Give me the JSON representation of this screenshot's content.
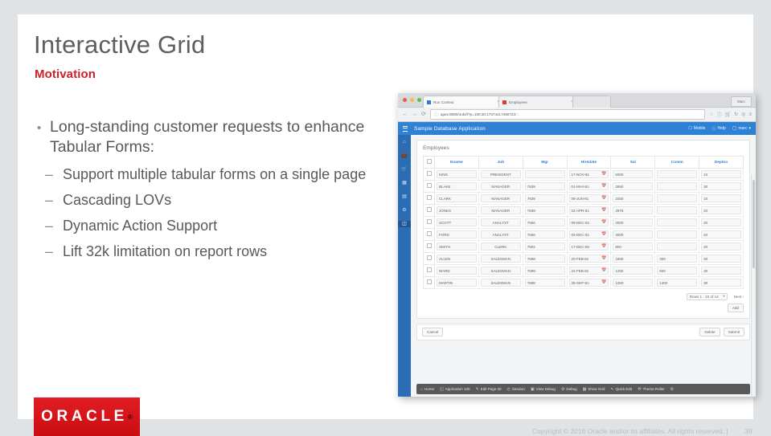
{
  "slide": {
    "title": "Interactive Grid",
    "subtitle": "Motivation",
    "bullets": {
      "main": "Long-standing customer requests to enhance Tabular Forms:",
      "bullet_marker": "•",
      "dash_marker": "–",
      "sub": [
        "Support multiple tabular forms on a single page",
        "Cascading LOVs",
        "Dynamic Action Support",
        "Lift 32k limitation on report rows"
      ]
    },
    "logo": {
      "word": "ORACLE",
      "registered": "®"
    },
    "footer": {
      "copyright": "Copyright © 2016 Oracle and/or its affiliates. All rights reserved.  |",
      "page_number": "39"
    },
    "colors": {
      "accent_red": "#cc2127",
      "title_gray": "#5b5f61",
      "oracle_red": "#d90b0b",
      "apex_blue": "#2f81d6"
    }
  },
  "screenshot": {
    "browser": {
      "window_buttons": [
        "close",
        "minimize",
        "zoom"
      ],
      "tabs": [
        {
          "label": "Run Context",
          "favicon": "blue-page-icon",
          "close": "×"
        },
        {
          "label": "Employees",
          "favicon": "red-page-icon",
          "close": "×"
        }
      ],
      "mac_menu_label": "Marc",
      "nav": {
        "back": "←",
        "forward": "→",
        "reload": "⟳",
        "lock_icon": "ⓘ",
        "url": "apex:8080/ords/f?p=100:30:17674417490723:::",
        "bookmark_icon": "☆",
        "info_icon": "ⓘ",
        "cart_icon": "🛒",
        "sync_icon": "↻",
        "profile_icon": "◎",
        "menu_icon": "≡"
      }
    },
    "apex_header": {
      "menu_icon": "hamburger-icon",
      "app_name": "Sample Database Application",
      "actions": [
        {
          "label": "Mobile",
          "icon": "mobile-icon"
        },
        {
          "label": "Help",
          "icon": "help-icon"
        },
        {
          "label": "marc",
          "icon": "user-icon",
          "caret": "▾"
        }
      ]
    },
    "sidebar_icons": [
      "home-icon",
      "briefcase-icon",
      "cart-icon",
      "card-icon",
      "book-icon",
      "gear-icon",
      "grid-icon"
    ],
    "active_sidebar_index": 6,
    "region": {
      "title": "Employees",
      "columns": [
        "Ename",
        "Job",
        "Mgr",
        "Hiredate",
        "Sal",
        "Comm",
        "Deptno"
      ],
      "calendar_icon": "calendar-icon",
      "rows": [
        {
          "ename": "KING",
          "job": "PRESIDENT",
          "mgr": "",
          "hiredate": "17-NOV-81",
          "sal": "5000",
          "comm": "",
          "deptno": "10"
        },
        {
          "ename": "BLAKE",
          "job": "MANAGER",
          "mgr": "7839",
          "hiredate": "01-MAY-81",
          "sal": "2850",
          "comm": "",
          "deptno": "30"
        },
        {
          "ename": "CLARK",
          "job": "MANAGER",
          "mgr": "7839",
          "hiredate": "09-JUN-81",
          "sal": "2450",
          "comm": "",
          "deptno": "10"
        },
        {
          "ename": "JONES",
          "job": "MANAGER",
          "mgr": "7839",
          "hiredate": "02-APR-81",
          "sal": "2975",
          "comm": "",
          "deptno": "20"
        },
        {
          "ename": "SCOTT",
          "job": "ANALYST",
          "mgr": "7566",
          "hiredate": "09-DEC-82",
          "sal": "3000",
          "comm": "",
          "deptno": "20"
        },
        {
          "ename": "FORD",
          "job": "ANALYST",
          "mgr": "7566",
          "hiredate": "03-DEC-81",
          "sal": "3000",
          "comm": "",
          "deptno": "20"
        },
        {
          "ename": "SMITH",
          "job": "CLERK",
          "mgr": "7902",
          "hiredate": "17-DEC-80",
          "sal": "800",
          "comm": "",
          "deptno": "20"
        },
        {
          "ename": "ALLEN",
          "job": "SALESMAN",
          "mgr": "7698",
          "hiredate": "20-FEB-81",
          "sal": "1600",
          "comm": "300",
          "deptno": "30"
        },
        {
          "ename": "WARD",
          "job": "SALESMAN",
          "mgr": "7698",
          "hiredate": "22-FEB-81",
          "sal": "1250",
          "comm": "500",
          "deptno": "30"
        },
        {
          "ename": "MARTIN",
          "job": "SALESMAN",
          "mgr": "7698",
          "hiredate": "28-SEP-81",
          "sal": "1250",
          "comm": "1400",
          "deptno": "30"
        }
      ],
      "pagination": {
        "rows_label": "Rows 1 - 10 of 14",
        "next_label": "Next ›"
      },
      "add_button": "Add"
    },
    "buttons": {
      "cancel": "Cancel",
      "delete": "Delete",
      "submit": "Submit"
    },
    "developer_toolbar": [
      {
        "label": "Home",
        "icon": "home-icon"
      },
      {
        "label": "Application 100",
        "icon": "application-icon"
      },
      {
        "label": "Edit Page 30",
        "icon": "edit-page-icon"
      },
      {
        "label": "Session",
        "icon": "session-icon"
      },
      {
        "label": "View Debug",
        "icon": "view-debug-icon"
      },
      {
        "label": "Debug",
        "icon": "debug-icon"
      },
      {
        "label": "Show Grid",
        "icon": "show-grid-icon"
      },
      {
        "label": "Quick Edit",
        "icon": "quick-edit-icon"
      },
      {
        "label": "Theme Roller",
        "icon": "theme-roller-icon"
      },
      {
        "label": "",
        "icon": "settings-icon"
      }
    ]
  }
}
